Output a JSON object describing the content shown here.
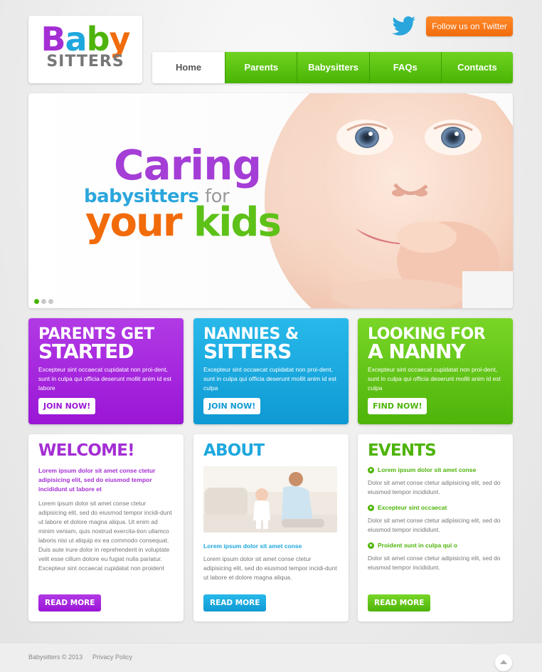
{
  "logo": {
    "baby_b": "B",
    "baby_a": "a",
    "baby_b2": "b",
    "baby_y": "y",
    "sitters": "SITTERS"
  },
  "header": {
    "follow": "Follow us on Twitter"
  },
  "nav": [
    "Home",
    "Parents",
    "Babysitters",
    "FAQs",
    "Contacts"
  ],
  "hero": {
    "line1": "Caring",
    "line2a": "babysitters",
    "line2b": "for",
    "line3a": "your",
    "line3b": "kids",
    "slides": 3,
    "active_slide": 1
  },
  "promos": [
    {
      "title_top": "PARENTS GET",
      "title_bottom": "STARTED",
      "text": "Excepteur sint occaecat cupidatat non proi-dent, sunt in culpa qui officia deserunt mollit anim id est labore",
      "button": "JOIN NOW!"
    },
    {
      "title_top": "NANNIES &",
      "title_bottom": "SITTERS",
      "text": "Excepteur sint occaecat cupidatat non proi-dent, sunt in culpa qui officia deserunt mollit anim id est culpa",
      "button": "JOIN NOW!"
    },
    {
      "title_top": "LOOKING FOR",
      "title_bottom": "A NANNY",
      "text": "Excepteur sint occaecat cupidatat non proi-dent, sunt in culpa qui officia deserunt mollit anim id est culpa",
      "button": "FIND NOW!"
    }
  ],
  "welcome": {
    "title": "WELCOME!",
    "lead": "Lorem ipsum dolor sit amet conse ctetur adipisicing elit, sed do eiusmod tempor incididunt ut labore et",
    "text": "Lorem ipsum dolor sit amet conse ctetur adipisicing elit, sed do eiusmod tempor incidi-dunt ut labore et dolore magna aliqua. Ut enim ad minim veniam, quis nostrud exercita-tion ullamco laboris nisi ut aliquip ex ea commodo consequat. Duis aute irure dolor in reprehenderit in voluptate velit esse cillum dolore eu fugiat nulla pariatur. Excepteur sint occaecat cupidatat non proident",
    "button": "READ MORE"
  },
  "about": {
    "title": "ABOUT",
    "link": "Lorem ipsum dolor sit amet conse",
    "text": "Lorem ipsum dolor sit amet conse ctetur adipisicing elit, sed do eiusmod tempor incidi-dunt ut labore et dolore magna aliqua.",
    "button": "READ MORE"
  },
  "events": {
    "title": "EVENTS",
    "items": [
      {
        "title": "Lorem ipsum dolor sit amet conse",
        "text": "Dolor sit amet conse ctetur adipisicing elit, sed do eiusmod tempor incididunt."
      },
      {
        "title": "Excepteur sint occaecat",
        "text": "Dolor sit amet conse ctetur adipisicing elit, sed do eiusmod tempor incididunt."
      },
      {
        "title": "Proident sunt in culpa qui o",
        "text": "Dolor sit amet conse ctetur adipisicing elit, sed do eiusmod tempor incididunt."
      }
    ],
    "button": "READ MORE"
  },
  "footer": {
    "copyright": "Babysitters © 2013",
    "privacy": "Privacy Policy"
  },
  "colors": {
    "purple": "#a42ed4",
    "blue": "#1ea8de",
    "green": "#4eb40a",
    "orange": "#f26b0b"
  }
}
